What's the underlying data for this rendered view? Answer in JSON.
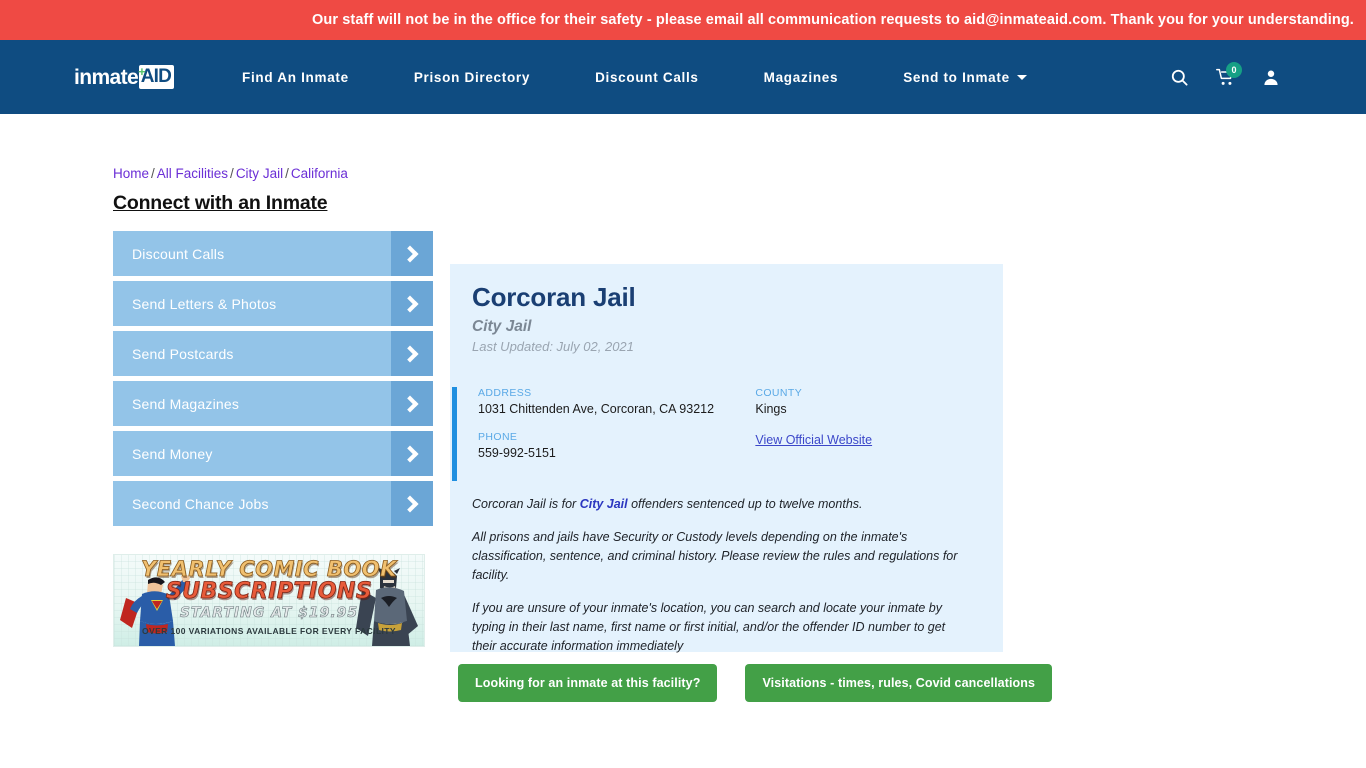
{
  "alert": {
    "text": "Our staff will not be in the office for their safety - please email all communication requests to aid@inmateaid.com. Thank you for your understanding.",
    "bg_color": "#ef4a44"
  },
  "navbar": {
    "bg_color": "#0f4c81",
    "logo": {
      "word": "inmate",
      "plus": "+",
      "box": "AID"
    },
    "links": [
      {
        "label": "Find An Inmate"
      },
      {
        "label": "Prison Directory"
      },
      {
        "label": "Discount Calls"
      },
      {
        "label": "Magazines"
      },
      {
        "label": "Send to Inmate",
        "dropdown": true
      }
    ],
    "icons": {
      "search": "search-icon",
      "cart": "shopping-cart-icon",
      "cart_count": "0",
      "cart_badge_color": "#16a085",
      "account": "user-account-icon"
    }
  },
  "breadcrumb": {
    "items": [
      "Home",
      "All Facilities",
      "City Jail",
      "California"
    ],
    "separator": "/",
    "link_color": "#6b2fd6"
  },
  "sidebar": {
    "title": "Connect with an Inmate",
    "items": [
      {
        "label": "Discount Calls"
      },
      {
        "label": "Send Letters & Photos"
      },
      {
        "label": "Send Postcards"
      },
      {
        "label": "Send Magazines"
      },
      {
        "label": "Send Money"
      },
      {
        "label": "Second Chance Jobs"
      }
    ],
    "button_color": "#93c4e8",
    "arrow_color": "#6ba6d6"
  },
  "ad": {
    "line1": "YEARLY COMIC BOOK",
    "line2": "SUBSCRIPTIONS",
    "line3": "STARTING AT $19.95",
    "line4": "OVER 100 VARIATIONS AVAILABLE FOR EVERY FACILITY"
  },
  "facility": {
    "name": "Corcoran Jail",
    "type": "City Jail",
    "last_updated": "Last Updated: July 02, 2021",
    "fields": {
      "address_label": "ADDRESS",
      "address_value": "1031 Chittenden Ave, Corcoran, CA 93212",
      "phone_label": "PHONE",
      "phone_value": "559-992-5151",
      "county_label": "COUNTY",
      "county_value": "Kings",
      "website_link": "View Official Website"
    },
    "description": {
      "p1_before": "Corcoran Jail is for ",
      "p1_link": "City Jail",
      "p1_after": " offenders sentenced up to twelve months.",
      "p2": "All prisons and jails have Security or Custody levels depending on the inmate's classification, sentence, and criminal history. Please review the rules and regulations for facility.",
      "p3": "If you are unsure of your inmate's location, you can search and locate your inmate by typing in their last name, first name or first initial, and/or the offender ID number to get their accurate information immediately"
    },
    "card_bg": "#e4f2fd",
    "accent_color": "#1f8fe0"
  },
  "actions": {
    "primary": "Looking for an inmate at this facility?",
    "secondary": "Visitations - times, rules, Covid cancellations",
    "color": "#43a047"
  }
}
